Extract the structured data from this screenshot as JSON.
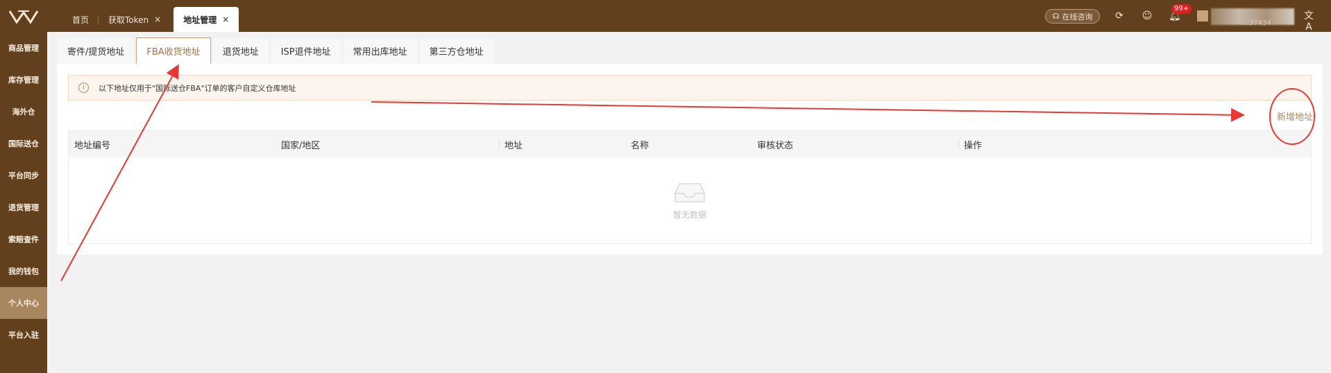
{
  "topbar": {
    "tabs": [
      {
        "label": "首页",
        "closable": false
      },
      {
        "label": "获取Token",
        "closable": true
      },
      {
        "label": "地址管理",
        "closable": true,
        "active": true
      }
    ],
    "close_glyph": "×",
    "online_consult": "在线咨询",
    "notification_count": "99+",
    "user_id_partial": "…37434"
  },
  "sidebar": {
    "items": [
      {
        "label": "商品管理"
      },
      {
        "label": "库存管理"
      },
      {
        "label": "海外仓"
      },
      {
        "label": "国际送仓"
      },
      {
        "label": "平台同步"
      },
      {
        "label": "退货管理"
      },
      {
        "label": "索赔查件"
      },
      {
        "label": "我的钱包"
      },
      {
        "label": "个人中心",
        "active": true
      },
      {
        "label": "平台入驻"
      }
    ]
  },
  "subtabs": [
    {
      "label": "寄件/提货地址"
    },
    {
      "label": "FBA收货地址",
      "active": true
    },
    {
      "label": "退货地址"
    },
    {
      "label": "ISP退件地址"
    },
    {
      "label": "常用出库地址"
    },
    {
      "label": "第三方仓地址"
    }
  ],
  "notice": {
    "text": "以下地址仅用于\"国际送仓FBA\"订单的客户自定义仓库地址"
  },
  "actions": {
    "add_address": "新增地址"
  },
  "table": {
    "columns": [
      "地址编号",
      "国家/地区",
      "地址",
      "名称",
      "审核状态",
      "操作"
    ],
    "rows": [],
    "empty_text": "暂无数据"
  },
  "colors": {
    "brand_dark": "#62401d",
    "brand_accent": "#a88660",
    "link": "#b0895c",
    "annotation_red": "#e53935"
  }
}
